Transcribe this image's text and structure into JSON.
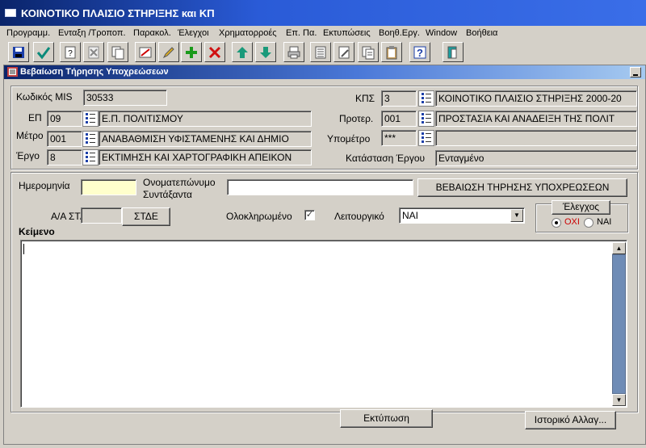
{
  "window": {
    "title": "ΚΟΙΝΟΤΙΚΟ ΠΛΑΙΣΙΟ ΣΤΗΡΙΞΗΣ και ΚΠ"
  },
  "menu": [
    "Προγραμμ.",
    "Ενταξη /Τροποπ.",
    "Παρακολ.",
    "Έλεγχοι",
    "Χρηματορροές",
    "Επ. Πα.",
    "Εκτυπώσεις",
    "Βοηθ.Εργ.",
    "Window",
    "Βοήθεια"
  ],
  "toolbar": {
    "icons": [
      "save-icon",
      "commit-check-icon",
      "query-icon",
      "clear-icon",
      "copy-record-icon",
      "edit-record-icon",
      "edit-pencil-icon",
      "insert-record-icon",
      "delete-record-icon",
      "previous-record-icon",
      "next-record-icon",
      "print-icon",
      "list-icon",
      "document-edit-icon",
      "document-icon",
      "clipboard-icon",
      "help-icon",
      "exit-icon"
    ]
  },
  "form": {
    "title": "Βεβαίωση Τήρησης Υποχρεώσεων",
    "header": {
      "mis_label": "Κωδικός MIS",
      "mis_value": "30533",
      "ep_label": "ΕΠ",
      "ep_code": "09",
      "ep_name": "Ε.Π. ΠΟΛΙΤΙΣΜΟΥ",
      "metro_label": "Μέτρο",
      "metro_code": "001",
      "metro_name": "ΑΝΑΒΑΘΜΙΣΗ ΥΦΙΣΤΑΜΕΝΗΣ ΚΑΙ ΔΗΜΙΟ",
      "ergo_label": "Έργο",
      "ergo_code": "8",
      "ergo_name": "ΕΚΤΙΜΗΣΗ ΚΑΙ ΧΑΡΤΟΓΡΑΦΙΚΗ ΑΠΕΙΚΟΝ",
      "kps_label": "ΚΠΣ",
      "kps_code": "3",
      "kps_name": "ΚΟΙΝΟΤΙΚΟ ΠΛΑΙΣΙΟ ΣΤΗΡΙΞΗΣ 2000-20",
      "proter_label": "Προτερ.",
      "proter_code": "001",
      "proter_name": "ΠΡΟΣΤΑΣΙΑ ΚΑΙ ΑΝΑΔΕΙΞΗ ΤΗΣ ΠΟΛΙΤ",
      "ypometro_label": "Υπομέτρο",
      "ypometro_code": "***",
      "ypometro_name": "",
      "katastasi_label": "Κατάσταση Έργου",
      "katastasi_value": "Ενταγμένο"
    },
    "detail": {
      "date_label": "Ημερομηνία",
      "date_value": "",
      "author_label_line1": "Ονοματεπώνυμο",
      "author_label_line2": "Συντάξαντα",
      "author_value": "",
      "cert_button": "ΒΕΒΑΙΩΣΗ ΤΗΡΗΣΗΣ ΥΠΟΧΡΕΩΣΕΩΝ",
      "aa_label": "Α/Α ΣΤΔΕ",
      "aa_value": "",
      "stde_button": "ΣΤΔΕ",
      "completed_label": "Ολοκληρωμένο",
      "completed_mark": "✓",
      "operational_label": "Λειτουργικό",
      "operational_value": "ΝΑΙ",
      "check_title": "Έλεγχος",
      "check_no": "ΟΧΙ",
      "check_yes": "ΝΑΙ",
      "text_label": "Κείμενο",
      "text_value": ""
    },
    "footer": {
      "print_button": "Εκτύπωση",
      "history_button": "Ιστορικό Αλλαγ..."
    }
  },
  "colors": {
    "titlebar": "#0a246a",
    "form_bg": "#d4d0c8",
    "date_field": "#ffffcc",
    "radio_selected_text": "#cc0000",
    "scroll_thumb": "#6f8cb6"
  }
}
